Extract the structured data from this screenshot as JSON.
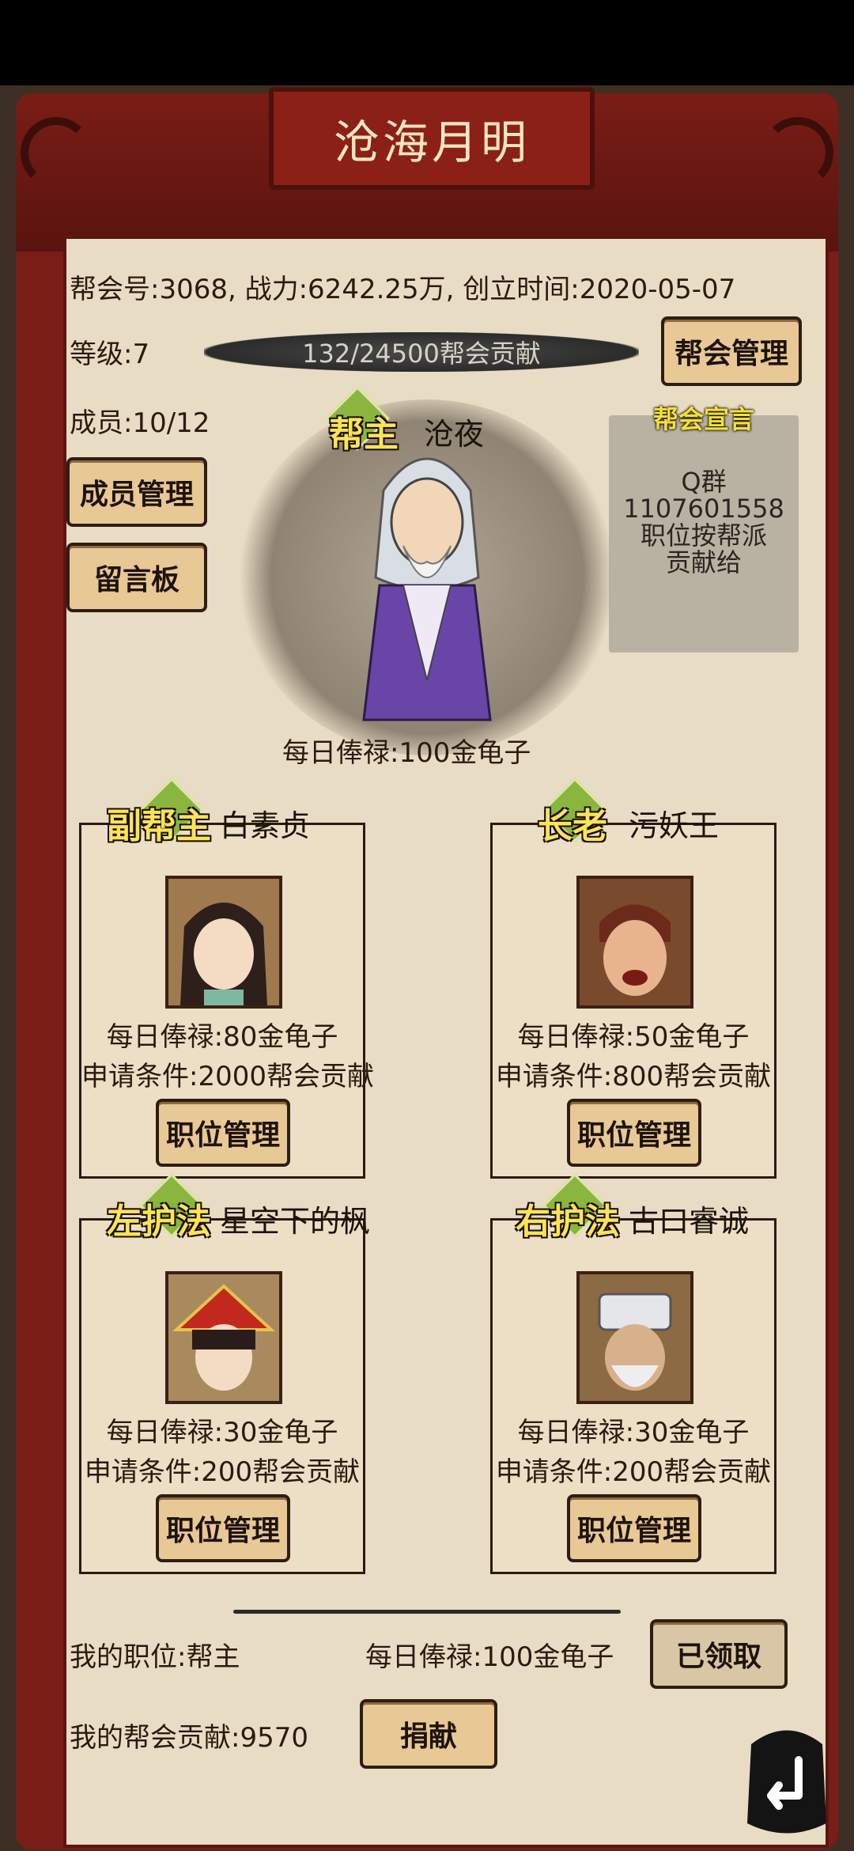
{
  "guild": {
    "name": "沧海月明",
    "info_line": "帮会号:3068, 战力:6242.25万, 创立时间:2020-05-07",
    "level_label": "等级:7",
    "progress_text": "132/24500帮会贡献",
    "progress_fraction": 0.0054,
    "members_label": "成员:10/12"
  },
  "buttons": {
    "guild_manage": "帮会管理",
    "member_manage": "成员管理",
    "message_board": "留言板",
    "position_manage": "职位管理",
    "claimed": "已领取",
    "donate": "捐献"
  },
  "declaration": {
    "title": "帮会宣言",
    "body": "Q群\n1107601558\n职位按帮派\n贡献给"
  },
  "leader": {
    "title": "帮主",
    "name": "沧夜",
    "salary": "每日俸禄:100金龟子"
  },
  "positions": [
    {
      "title": "副帮主",
      "name": "白素贞",
      "salary": "每日俸禄:80金龟子",
      "requirement": "申请条件:2000帮会贡献",
      "portrait_icon": "female-warrior-portrait-icon"
    },
    {
      "title": "长老",
      "name": "污妖王",
      "salary": "每日俸禄:50金龟子",
      "requirement": "申请条件:800帮会贡献",
      "portrait_icon": "angry-man-portrait-icon"
    },
    {
      "title": "左护法",
      "name": "星空下的枫",
      "salary": "每日俸禄:30金龟子",
      "requirement": "申请条件:200帮会贡献",
      "portrait_icon": "girl-red-hat-portrait-icon"
    },
    {
      "title": "右护法",
      "name": "古口睿诚",
      "salary": "每日俸禄:30金龟子",
      "requirement": "申请条件:200帮会贡献",
      "portrait_icon": "old-man-white-hat-portrait-icon"
    }
  ],
  "footer": {
    "my_position": "我的职位:帮主",
    "my_salary": "每日俸禄:100金龟子",
    "my_contribution": "我的帮会贡献:9570"
  },
  "colors": {
    "frame": "#7a1d16",
    "parchment": "#e9dcc4",
    "gold_title": "#fbe35a",
    "button": "#e8c894"
  }
}
